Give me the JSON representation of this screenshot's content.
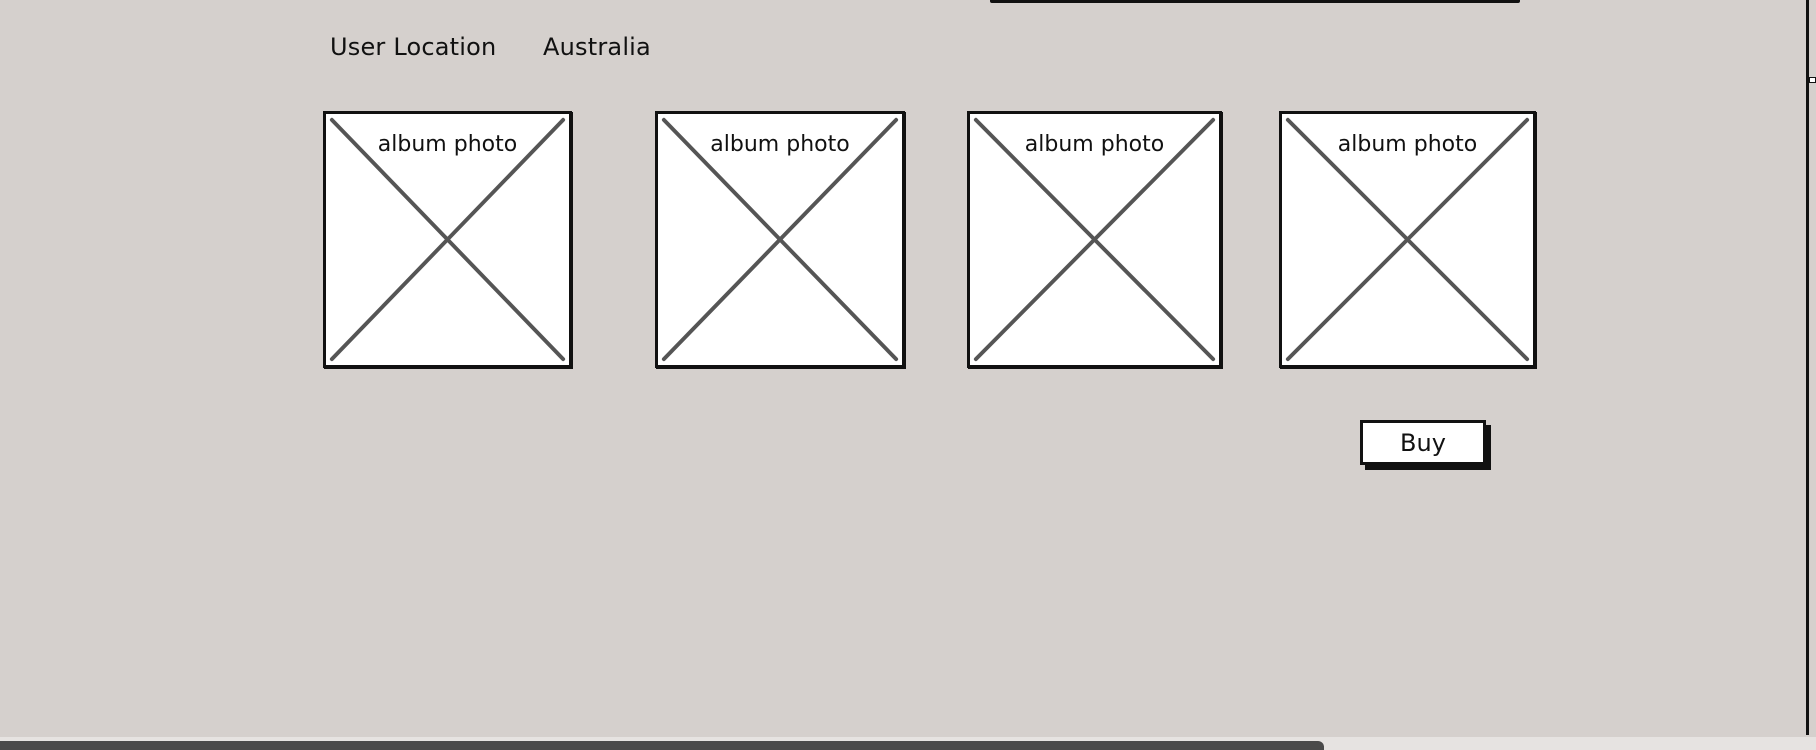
{
  "user_location": {
    "label": "User Location",
    "value": "Australia"
  },
  "albums": [
    {
      "label": "album photo"
    },
    {
      "label": "album photo"
    },
    {
      "label": "album photo"
    },
    {
      "label": "album photo"
    }
  ],
  "actions": {
    "buy_label": "Buy"
  }
}
